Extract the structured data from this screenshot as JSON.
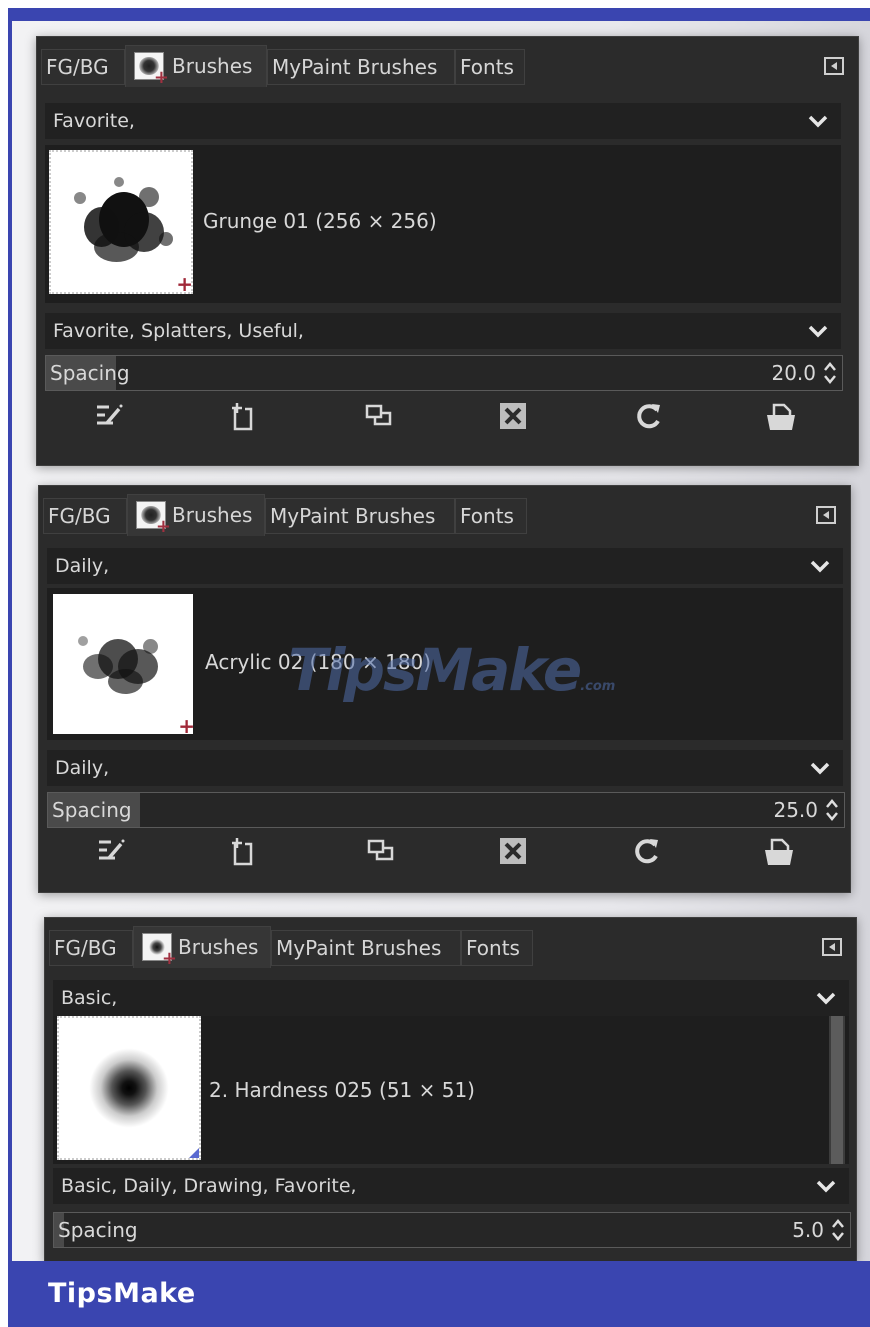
{
  "tabs": {
    "fg_bg": "FG/BG",
    "brushes": "Brushes",
    "mypaint": "MyPaint Brushes",
    "fonts": "Fonts"
  },
  "panels": [
    {
      "tag_filter": "Favorite,",
      "brush_name": "Grunge 01 (256 × 256)",
      "brush_tags": "Favorite, Splatters, Useful,",
      "spacing_label": "Spacing",
      "spacing_value": "20.0",
      "spacing_fraction": 0.2
    },
    {
      "tag_filter": "Daily,",
      "brush_name": "Acrylic 02 (180 × 180)",
      "brush_tags": "Daily,",
      "spacing_label": "Spacing",
      "spacing_value": "25.0",
      "spacing_fraction": 0.25
    },
    {
      "tag_filter": "Basic,",
      "brush_name": "2. Hardness 025 (51 × 51)",
      "brush_tags": "Basic, Daily, Drawing, Favorite,",
      "spacing_label": "Spacing",
      "spacing_value": "5.0",
      "spacing_fraction": 0.05
    }
  ],
  "toolbar_icons": [
    "edit-brush-icon",
    "new-brush-icon",
    "duplicate-brush-icon",
    "delete-brush-icon",
    "refresh-brushes-icon",
    "open-as-image-icon"
  ],
  "watermark": {
    "main": "TipsMake",
    "suffix": ".com"
  },
  "brand": "TipsMake",
  "colors": {
    "frame_blue": "#3a45b0",
    "panel_bg": "#2b2b2b",
    "text": "#d8d8d8",
    "plus_marker": "#a02838"
  }
}
